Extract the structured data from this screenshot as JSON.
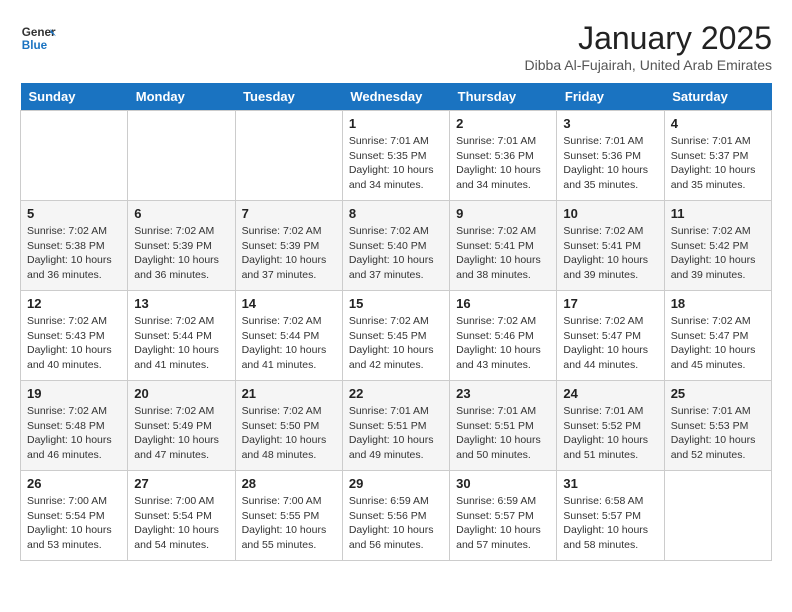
{
  "logo": {
    "line1": "General",
    "line2": "Blue"
  },
  "title": "January 2025",
  "location": "Dibba Al-Fujairah, United Arab Emirates",
  "weekdays": [
    "Sunday",
    "Monday",
    "Tuesday",
    "Wednesday",
    "Thursday",
    "Friday",
    "Saturday"
  ],
  "weeks": [
    [
      {
        "day": "",
        "info": ""
      },
      {
        "day": "",
        "info": ""
      },
      {
        "day": "",
        "info": ""
      },
      {
        "day": "1",
        "info": "Sunrise: 7:01 AM\nSunset: 5:35 PM\nDaylight: 10 hours\nand 34 minutes."
      },
      {
        "day": "2",
        "info": "Sunrise: 7:01 AM\nSunset: 5:36 PM\nDaylight: 10 hours\nand 34 minutes."
      },
      {
        "day": "3",
        "info": "Sunrise: 7:01 AM\nSunset: 5:36 PM\nDaylight: 10 hours\nand 35 minutes."
      },
      {
        "day": "4",
        "info": "Sunrise: 7:01 AM\nSunset: 5:37 PM\nDaylight: 10 hours\nand 35 minutes."
      }
    ],
    [
      {
        "day": "5",
        "info": "Sunrise: 7:02 AM\nSunset: 5:38 PM\nDaylight: 10 hours\nand 36 minutes."
      },
      {
        "day": "6",
        "info": "Sunrise: 7:02 AM\nSunset: 5:39 PM\nDaylight: 10 hours\nand 36 minutes."
      },
      {
        "day": "7",
        "info": "Sunrise: 7:02 AM\nSunset: 5:39 PM\nDaylight: 10 hours\nand 37 minutes."
      },
      {
        "day": "8",
        "info": "Sunrise: 7:02 AM\nSunset: 5:40 PM\nDaylight: 10 hours\nand 37 minutes."
      },
      {
        "day": "9",
        "info": "Sunrise: 7:02 AM\nSunset: 5:41 PM\nDaylight: 10 hours\nand 38 minutes."
      },
      {
        "day": "10",
        "info": "Sunrise: 7:02 AM\nSunset: 5:41 PM\nDaylight: 10 hours\nand 39 minutes."
      },
      {
        "day": "11",
        "info": "Sunrise: 7:02 AM\nSunset: 5:42 PM\nDaylight: 10 hours\nand 39 minutes."
      }
    ],
    [
      {
        "day": "12",
        "info": "Sunrise: 7:02 AM\nSunset: 5:43 PM\nDaylight: 10 hours\nand 40 minutes."
      },
      {
        "day": "13",
        "info": "Sunrise: 7:02 AM\nSunset: 5:44 PM\nDaylight: 10 hours\nand 41 minutes."
      },
      {
        "day": "14",
        "info": "Sunrise: 7:02 AM\nSunset: 5:44 PM\nDaylight: 10 hours\nand 41 minutes."
      },
      {
        "day": "15",
        "info": "Sunrise: 7:02 AM\nSunset: 5:45 PM\nDaylight: 10 hours\nand 42 minutes."
      },
      {
        "day": "16",
        "info": "Sunrise: 7:02 AM\nSunset: 5:46 PM\nDaylight: 10 hours\nand 43 minutes."
      },
      {
        "day": "17",
        "info": "Sunrise: 7:02 AM\nSunset: 5:47 PM\nDaylight: 10 hours\nand 44 minutes."
      },
      {
        "day": "18",
        "info": "Sunrise: 7:02 AM\nSunset: 5:47 PM\nDaylight: 10 hours\nand 45 minutes."
      }
    ],
    [
      {
        "day": "19",
        "info": "Sunrise: 7:02 AM\nSunset: 5:48 PM\nDaylight: 10 hours\nand 46 minutes."
      },
      {
        "day": "20",
        "info": "Sunrise: 7:02 AM\nSunset: 5:49 PM\nDaylight: 10 hours\nand 47 minutes."
      },
      {
        "day": "21",
        "info": "Sunrise: 7:02 AM\nSunset: 5:50 PM\nDaylight: 10 hours\nand 48 minutes."
      },
      {
        "day": "22",
        "info": "Sunrise: 7:01 AM\nSunset: 5:51 PM\nDaylight: 10 hours\nand 49 minutes."
      },
      {
        "day": "23",
        "info": "Sunrise: 7:01 AM\nSunset: 5:51 PM\nDaylight: 10 hours\nand 50 minutes."
      },
      {
        "day": "24",
        "info": "Sunrise: 7:01 AM\nSunset: 5:52 PM\nDaylight: 10 hours\nand 51 minutes."
      },
      {
        "day": "25",
        "info": "Sunrise: 7:01 AM\nSunset: 5:53 PM\nDaylight: 10 hours\nand 52 minutes."
      }
    ],
    [
      {
        "day": "26",
        "info": "Sunrise: 7:00 AM\nSunset: 5:54 PM\nDaylight: 10 hours\nand 53 minutes."
      },
      {
        "day": "27",
        "info": "Sunrise: 7:00 AM\nSunset: 5:54 PM\nDaylight: 10 hours\nand 54 minutes."
      },
      {
        "day": "28",
        "info": "Sunrise: 7:00 AM\nSunset: 5:55 PM\nDaylight: 10 hours\nand 55 minutes."
      },
      {
        "day": "29",
        "info": "Sunrise: 6:59 AM\nSunset: 5:56 PM\nDaylight: 10 hours\nand 56 minutes."
      },
      {
        "day": "30",
        "info": "Sunrise: 6:59 AM\nSunset: 5:57 PM\nDaylight: 10 hours\nand 57 minutes."
      },
      {
        "day": "31",
        "info": "Sunrise: 6:58 AM\nSunset: 5:57 PM\nDaylight: 10 hours\nand 58 minutes."
      },
      {
        "day": "",
        "info": ""
      }
    ]
  ]
}
